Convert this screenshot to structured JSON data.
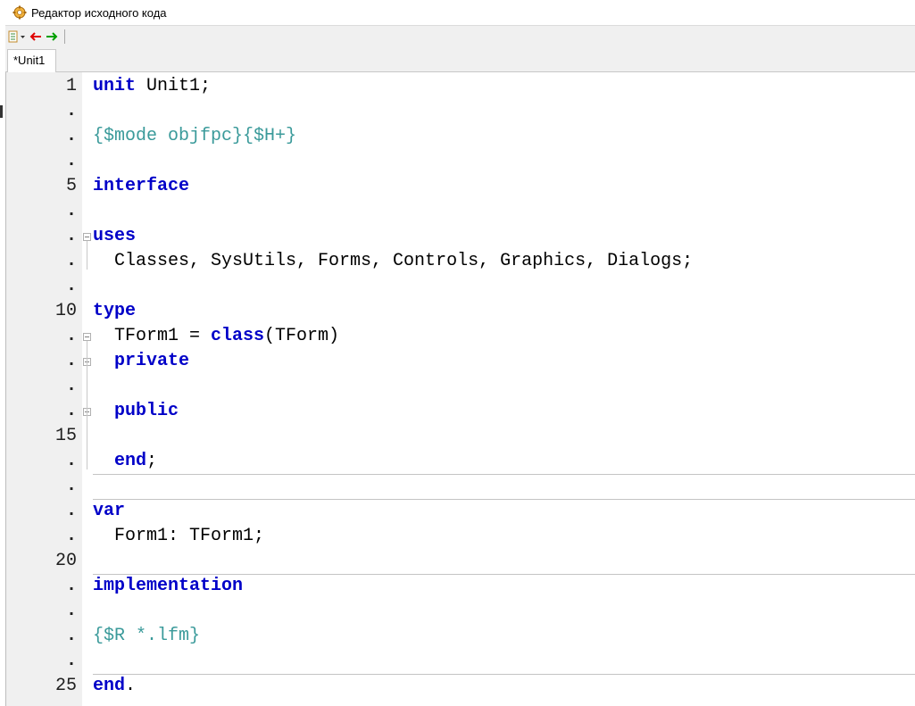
{
  "window": {
    "title": "Редактор исходного кода",
    "icon": "source-editor-icon"
  },
  "toolbar": {
    "items": [
      {
        "name": "jump-list-icon",
        "type": "dropdown"
      },
      {
        "name": "back-arrow-icon",
        "color": "#e00000"
      },
      {
        "name": "forward-arrow-icon",
        "color": "#00a000"
      }
    ]
  },
  "tabs": [
    {
      "label": "*Unit1",
      "active": true
    }
  ],
  "colors": {
    "keyword": "#0000c8",
    "directive": "#3a9a9a",
    "text": "#000000",
    "gutter_bg": "#f0f0f0",
    "line_number": "#202020"
  },
  "editor": {
    "lines": [
      {
        "num": "1",
        "tokens": [
          {
            "t": "unit",
            "c": "kw"
          },
          {
            "t": " Unit1;",
            "c": ""
          }
        ]
      },
      {
        "num": ".",
        "tokens": []
      },
      {
        "num": ".",
        "tokens": [
          {
            "t": "{$mode objfpc}{$H+}",
            "c": "dir"
          }
        ]
      },
      {
        "num": ".",
        "tokens": []
      },
      {
        "num": "5",
        "tokens": [
          {
            "t": "interface",
            "c": "kw"
          }
        ]
      },
      {
        "num": ".",
        "tokens": []
      },
      {
        "num": ".",
        "tokens": [
          {
            "t": "uses",
            "c": "kw"
          }
        ]
      },
      {
        "num": ".",
        "tokens": [
          {
            "t": "  Classes, SysUtils, Forms, Controls, Graphics, Dialogs;",
            "c": ""
          }
        ]
      },
      {
        "num": ".",
        "tokens": []
      },
      {
        "num": "10",
        "tokens": [
          {
            "t": "type",
            "c": "kw"
          }
        ]
      },
      {
        "num": ".",
        "tokens": [
          {
            "t": "  TForm1 = ",
            "c": ""
          },
          {
            "t": "class",
            "c": "kw"
          },
          {
            "t": "(TForm)",
            "c": ""
          }
        ]
      },
      {
        "num": ".",
        "tokens": [
          {
            "t": "  ",
            "c": ""
          },
          {
            "t": "private",
            "c": "kw"
          }
        ]
      },
      {
        "num": ".",
        "tokens": []
      },
      {
        "num": ".",
        "tokens": [
          {
            "t": "  ",
            "c": ""
          },
          {
            "t": "public",
            "c": "kw"
          }
        ]
      },
      {
        "num": "15",
        "tokens": []
      },
      {
        "num": ".",
        "tokens": [
          {
            "t": "  ",
            "c": ""
          },
          {
            "t": "end",
            "c": "kw"
          },
          {
            "t": ";",
            "c": ""
          }
        ]
      },
      {
        "num": ".",
        "tokens": []
      },
      {
        "num": ".",
        "tokens": [
          {
            "t": "var",
            "c": "kw"
          }
        ]
      },
      {
        "num": ".",
        "tokens": [
          {
            "t": "  Form1: TForm1;",
            "c": ""
          }
        ]
      },
      {
        "num": "20",
        "tokens": []
      },
      {
        "num": ".",
        "tokens": [
          {
            "t": "implementation",
            "c": "kw"
          }
        ]
      },
      {
        "num": ".",
        "tokens": []
      },
      {
        "num": ".",
        "tokens": [
          {
            "t": "{$R *.lfm}",
            "c": "dir"
          }
        ]
      },
      {
        "num": ".",
        "tokens": []
      },
      {
        "num": "25",
        "tokens": [
          {
            "t": "end",
            "c": "kw"
          },
          {
            "t": ".",
            "c": ""
          }
        ]
      }
    ],
    "fold_markers": [
      {
        "line": 7,
        "name": "fold-uses-icon"
      },
      {
        "line": 11,
        "name": "fold-class-icon"
      },
      {
        "line": 12,
        "name": "fold-private-icon"
      },
      {
        "line": 14,
        "name": "fold-public-icon"
      }
    ],
    "separators_after_lines": [
      16,
      17,
      20,
      24
    ]
  }
}
